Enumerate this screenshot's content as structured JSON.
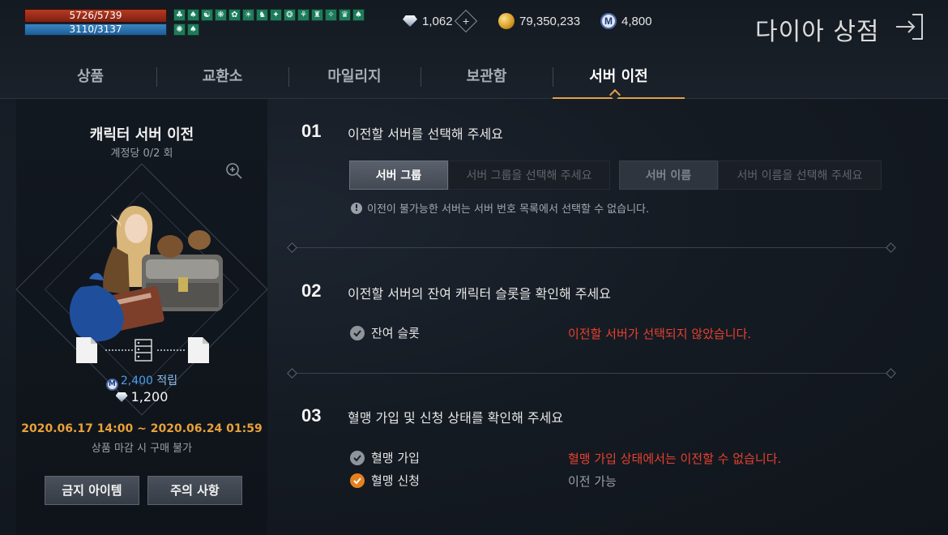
{
  "hud": {
    "hp": "5726/5739",
    "mp": "3110/3137",
    "buff_icons_row1": [
      "♣",
      "♠",
      "☯",
      "❋",
      "✿",
      "☀",
      "♞",
      "✦",
      "❂",
      "⚘",
      "♜",
      "✧",
      "♛",
      "♠"
    ],
    "buff_icons_row2": [
      "✺",
      "♠"
    ]
  },
  "currencies": {
    "diamond": "1,062",
    "gold": "79,350,233",
    "mileage": "4,800",
    "mileage_symbol": "M"
  },
  "shop": {
    "title": "다이아 상점"
  },
  "tabs": [
    {
      "label": "상품"
    },
    {
      "label": "교환소"
    },
    {
      "label": "마일리지"
    },
    {
      "label": "보관함"
    },
    {
      "label": "서버 이전"
    }
  ],
  "product": {
    "title": "캐릭터 서버 이전",
    "limit": "계정당 0/2 회",
    "mileage_amount": "2,400",
    "mileage_suffix": "적립",
    "mileage_symbol": "M",
    "price": "1,200",
    "sale_period": "2020.06.17 14:00 ~ 2020.06.24 01:59",
    "sale_note": "상품 마감 시 구매 불가",
    "btn_banned": "금지 아이템",
    "btn_notice": "주의 사항"
  },
  "steps": [
    {
      "num": "01",
      "title": "이전할 서버를 선택해 주세요"
    },
    {
      "num": "02",
      "title": "이전할 서버의 잔여 캐릭터 슬롯을 확인해 주세요"
    },
    {
      "num": "03",
      "title": "혈맹 가입 및 신청 상태를 확인해 주세요"
    }
  ],
  "server_select": {
    "group_label": "서버 그룹",
    "group_placeholder": "서버 그룹을 선택해 주세요",
    "name_label": "서버 이름",
    "name_placeholder": "서버 이름을 선택해 주세요",
    "warning": "이전이 불가능한 서버는 서버 번호 목록에서 선택할 수 없습니다."
  },
  "slot_check": {
    "label": "잔여 슬롯",
    "status": "이전할 서버가 선택되지 않았습니다."
  },
  "clan_check": {
    "join_label": "혈맹 가입",
    "join_status": "혈맹 가입 상태에서는 이전할 수 없습니다.",
    "apply_label": "혈맹 신청",
    "apply_status": "이전 가능"
  },
  "colors": {
    "accent_orange": "#e0a04a",
    "error_red": "#e8402f",
    "mileage_blue": "#4d9ff0",
    "check_orange": "#e5801e"
  }
}
